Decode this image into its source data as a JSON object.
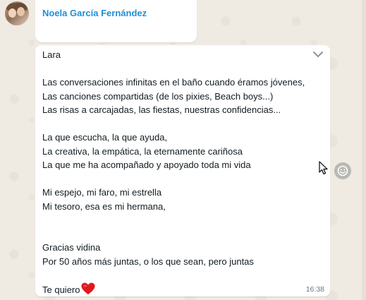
{
  "sender": {
    "name": "Noela García Fernández"
  },
  "message": {
    "lines": [
      "Lara",
      "",
      "Las conversaciones infinitas en el baño cuando éramos jóvenes,",
      "Las canciones compartidas (de los pixies, Beach boys...)",
      "Las risas a carcajadas, las fiestas, nuestras confidencias...",
      "",
      "La que escucha, la que ayuda,",
      "La creativa, la empática, la eternamente cariñosa",
      "La que me ha acompañado y apoyado toda mi vida",
      "",
      "Mi espejo, mi faro, mi estrella",
      "Mi tesoro, esa es mi hermana,",
      "",
      "",
      "Gracias vidina",
      "Por 50 años más juntas, o los que sean, pero juntas",
      "",
      "Te quiero"
    ],
    "emoji": "red-heart",
    "time": "16:38"
  },
  "icons": {
    "menu": "chevron-down-icon",
    "reaction": "smiley-icon",
    "cursor": "mouse-pointer-icon"
  },
  "colors": {
    "background": "#efeae2",
    "bubble": "#ffffff",
    "sender_name": "#1e8fd6",
    "text": "#111b21",
    "timestamp": "#667781",
    "heart": "#e0191f"
  }
}
